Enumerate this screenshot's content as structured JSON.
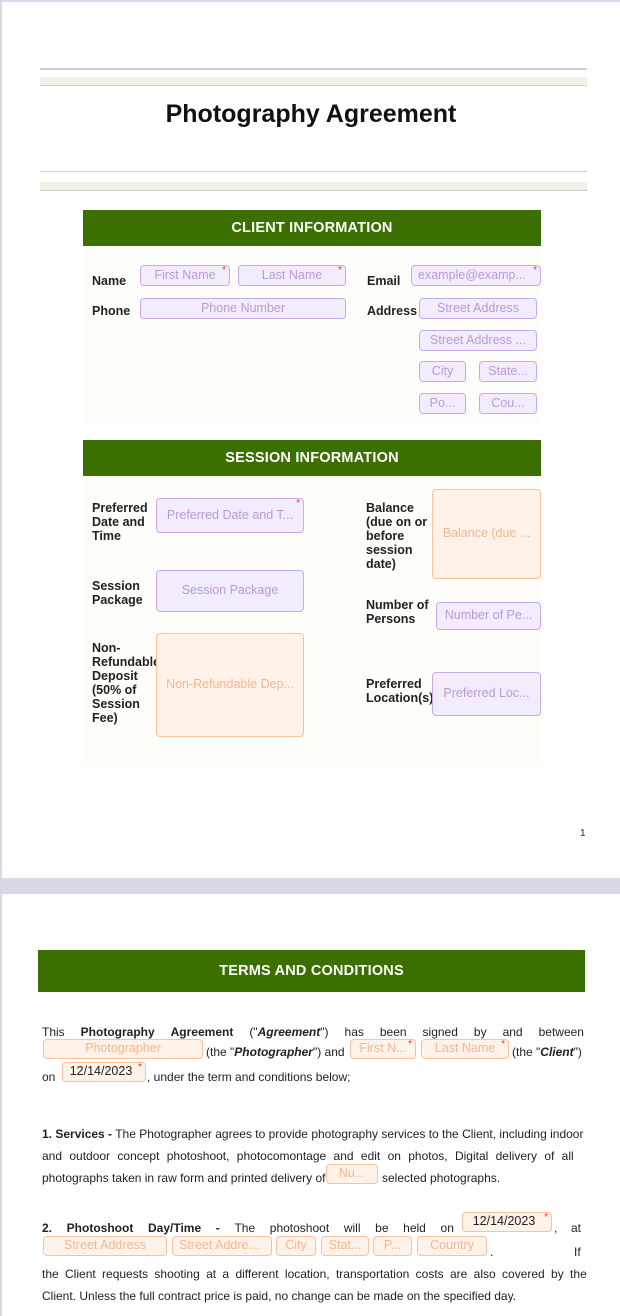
{
  "document": {
    "title": "Photography Agreement",
    "page_number": "1",
    "brand_color": "#3b7000",
    "field_colors": {
      "optional": "#c9a9ea",
      "fill": "#f4b794"
    }
  },
  "client_information": {
    "header": "CLIENT INFORMATION",
    "name_label": "Name",
    "first_name_placeholder": "First Name",
    "last_name_placeholder": "Last Name",
    "email_label": "Email",
    "email_placeholder": "example@examp...",
    "phone_label": "Phone",
    "phone_placeholder": "Phone Number",
    "address_label": "Address",
    "street_placeholder": "Street Address",
    "street2_placeholder": "Street Address ...",
    "city_placeholder": "City",
    "state_placeholder": "State...",
    "postal_placeholder": "Po...",
    "country_placeholder": "Cou..."
  },
  "session_information": {
    "header": "SESSION INFORMATION",
    "date_label": "Preferred Date and Time",
    "date_placeholder": "Preferred Date and T...",
    "package_label": "Session Package",
    "package_placeholder": "Session Package",
    "deposit_label": "Non-Refundable Deposit (50% of Session Fee)",
    "deposit_placeholder": "Non-Refundable Dep...",
    "balance_label": "Balance (due on or before session date)",
    "balance_placeholder": "Balance (due ...",
    "persons_label": "Number of Persons",
    "persons_placeholder": "Number of Pe...",
    "location_label": "Preferred Location(s)",
    "location_placeholder": "Preferred Loc..."
  },
  "terms": {
    "header": "TERMS AND CONDITIONS",
    "intro": {
      "w1": "This",
      "w2": "Photography",
      "w3": "Agreement",
      "w4a": "(\"",
      "w4b": "Agreement",
      "w4c": "\")",
      "w5": "has",
      "w6": "been",
      "w7": "signed",
      "w8": "by",
      "w9": "and",
      "w10": "between",
      "photographer_placeholder": "Photographer",
      "the_photographer_a": "(the \"",
      "the_photographer_b": "Photographer",
      "the_photographer_c": "\") and",
      "client_first_placeholder": "First N...",
      "client_last_placeholder": "Last Name",
      "the_client_a": "(the \"",
      "the_client_b": "Client",
      "the_client_c": "\")",
      "on": "on",
      "date_value": "12/14/2023",
      "tail": ", under the term and conditions below;"
    },
    "services": {
      "heading": "1. Services -",
      "line1": "The Photographer agrees to provide photography services to the Client, including indoor",
      "line2": "and outdoor concept photoshoot, photocomontage and edit on photos, Digital delivery of all",
      "line3a": "photographs taken in raw form and printed delivery of",
      "number_placeholder": "Nu...",
      "line3b": "selected photographs."
    },
    "photoshoot": {
      "heading_a": "2.",
      "heading_b": "Photoshoot",
      "heading_c": "Day/Time",
      "heading_d": "-",
      "w1": "The",
      "w2": "photoshoot",
      "w3": "will",
      "w4": "be",
      "w5": "held",
      "w6": "on",
      "date_value": "12/14/2023",
      "comma_at": ",",
      "at": "at",
      "street_placeholder": "Street Address",
      "street2_placeholder": "Street Addres...",
      "city_placeholder": "City",
      "state_placeholder": "Stat...",
      "postal_placeholder": "P...",
      "country_placeholder": "Country",
      "period": ".",
      "if": "If",
      "line3": "the Client requests shooting at a different location, transportation costs are also covered by the",
      "line4": "Client. Unless the full contract price is paid, no change can be made on the specified day."
    }
  }
}
